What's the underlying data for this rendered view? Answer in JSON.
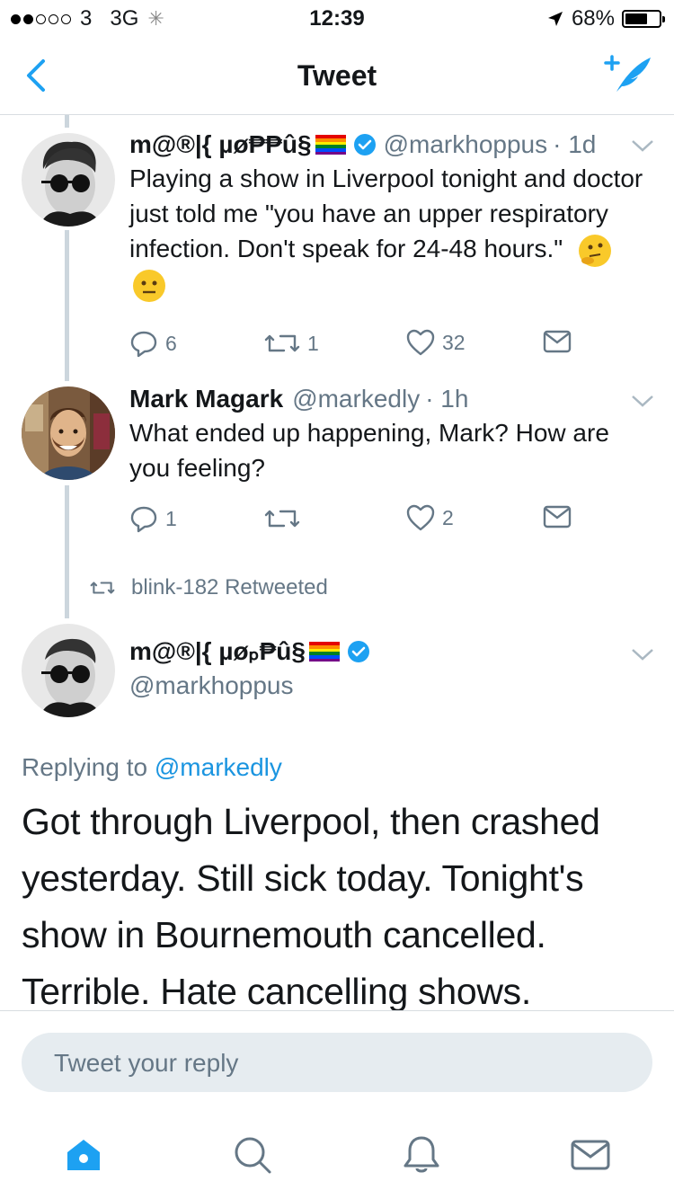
{
  "status_bar": {
    "carrier": "3",
    "network": "3G",
    "time": "12:39",
    "battery": "68%",
    "battery_level": 0.68
  },
  "nav": {
    "title": "Tweet"
  },
  "tweets": [
    {
      "name": "m@®|{ µø₱₱û§",
      "handle": "@markhoppus",
      "time": "· 1d",
      "text_main": "Playing a show in Liverpool tonight and doctor just told me \"you have an upper respiratory infection. Don't speak for 24-48 hours.\"",
      "replies": "6",
      "retweets": "1",
      "likes": "32"
    },
    {
      "name": "Mark Magark",
      "handle": "@markedly",
      "time": "· 1h",
      "text_main": "What ended up happening, Mark? How are you feeling?",
      "replies": "1",
      "retweets": "",
      "likes": "2"
    }
  ],
  "retweet_label": "blink-182 Retweeted",
  "focused_tweet": {
    "name": "m@®|{ µøₚ₱û§",
    "handle": "@markhoppus",
    "replying_prefix": "Replying to",
    "replying_handle": "@markedly",
    "text": "Got through Liverpool, then crashed yesterday. Still sick today. Tonight's show in Bournemouth cancelled. Terrible. Hate cancelling shows."
  },
  "composer": {
    "placeholder": "Tweet your reply"
  },
  "colors": {
    "accent": "#1da1f2",
    "text": "#14171a",
    "muted": "#657786",
    "thread": "#ccd6dd"
  },
  "icons": [
    "back-chevron-icon",
    "compose-icon",
    "verified-icon",
    "reply-icon",
    "retweet-icon",
    "like-icon",
    "dm-icon",
    "home-icon",
    "search-icon",
    "notifications-icon",
    "messages-icon"
  ]
}
